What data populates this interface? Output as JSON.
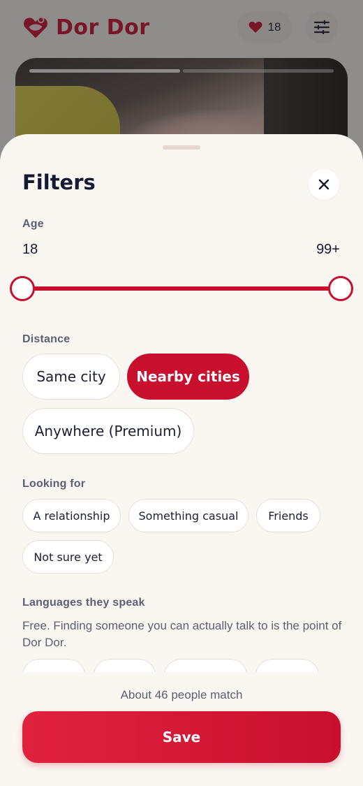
{
  "app": {
    "name": "Dor Dor",
    "likes_count": "18"
  },
  "colors": {
    "accent": "#c8102e",
    "sheet_bg": "#faf7f2",
    "text": "#141a33",
    "muted": "#5b6072"
  },
  "icons": {
    "logo": "heart-logo-icon",
    "likes": "heart-icon",
    "filters": "sliders-icon",
    "close": "close-icon"
  },
  "sheet": {
    "title": "Filters",
    "age": {
      "label": "Age",
      "min": "18",
      "max": "99+",
      "range": [
        18,
        99
      ]
    },
    "distance": {
      "label": "Distance",
      "options": [
        {
          "label": "Same city",
          "selected": false
        },
        {
          "label": "Nearby cities",
          "selected": true
        },
        {
          "label": "Anywhere (Premium)",
          "selected": false
        }
      ]
    },
    "looking_for": {
      "label": "Looking for",
      "options": [
        {
          "label": "A relationship",
          "selected": false
        },
        {
          "label": "Something casual",
          "selected": false
        },
        {
          "label": "Friends",
          "selected": false
        },
        {
          "label": "Not sure yet",
          "selected": false
        }
      ]
    },
    "languages": {
      "label": "Languages they speak",
      "description": "Free. Finding someone you can actually talk to is the point of Dor Dor."
    },
    "match_text": "About 46 people match",
    "save_label": "Save"
  }
}
